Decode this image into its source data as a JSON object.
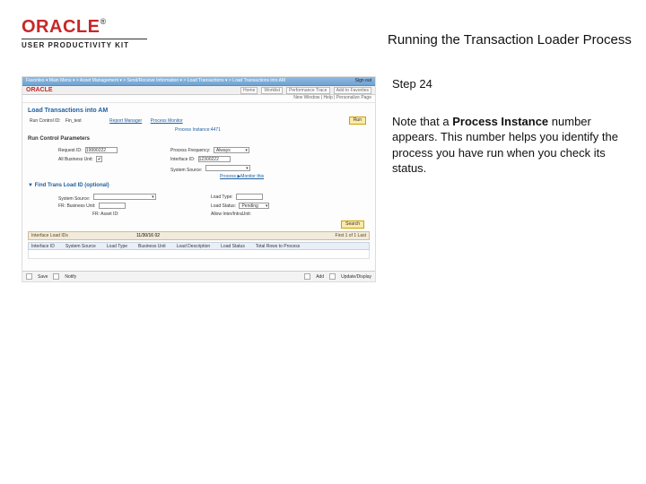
{
  "header": {
    "brand": "ORACLE",
    "tm": "®",
    "subline": "USER PRODUCTIVITY KIT",
    "title": "Running the Transaction Loader Process"
  },
  "right": {
    "step": "Step 24",
    "note_pre": "Note that a ",
    "note_bold": "Process Instance",
    "note_post": " number appears. This number helps you identify the process you have run when you check its status."
  },
  "ss": {
    "signout": "Sign out",
    "breadcrumb_left": "Favorites ▾   Main Menu ▾  >  Asset Management ▾  >  Send/Receive Information ▾  >  Load Transactions ▾  >  Load Transactions into AM",
    "mini_tabs": [
      "Home",
      "Worklist",
      "Performance Trace",
      "Add to Favorites"
    ],
    "toolbar_right": "New Window | Help | Personalize Page",
    "page_h1": "Load Transactions into AM",
    "runctl_label": "Run Control ID:",
    "runctl_value": "Fin_test",
    "report_mgr": "Report Manager",
    "process_mon": "Process Monitor",
    "run_btn": "Run",
    "process_instance": "Process Instance:4471",
    "run_params_title": "Run Control Parameters",
    "request_id_lbl": "Request ID:",
    "request_id_val": "19990222",
    "process_freq_lbl": "Process Frequency:",
    "process_freq_val": "Always",
    "all_bu_lbl": "All Business Unit:",
    "all_bu_box": "✔",
    "interface_lbl": "Interface ID:",
    "interface_val": "12300222",
    "system_source_lbl": "System Source:",
    "process_mon_link": "Process ▶Monitor this",
    "find_title": "Find Trans Load ID (optional)",
    "system_source2_lbl": "System Source:",
    "load_type_lbl": "Load Type:",
    "fr_bu_lbl": "FR: Business Unit:",
    "load_status_lbl": "Load Status:",
    "load_status_val": "Pending",
    "fr_asset_lbl": "FR: Asset ID:",
    "allow_int_lbl": "Allow Inter/IntraUnit:",
    "search_btn": "Search",
    "strip_title": "Interface Load IDs",
    "strip_right": "First 1 of 1 Last",
    "strip_date": "11/30/16 02",
    "grid_cols": [
      "Interface ID",
      "System Source",
      "Load Type",
      "Business Unit",
      "Load Description",
      "Load Status",
      "Total Rows to Process"
    ],
    "bottom_save": "Save",
    "bottom_notify": "Notify",
    "bottom_add": "Add",
    "bottom_update": "Update/Display"
  }
}
